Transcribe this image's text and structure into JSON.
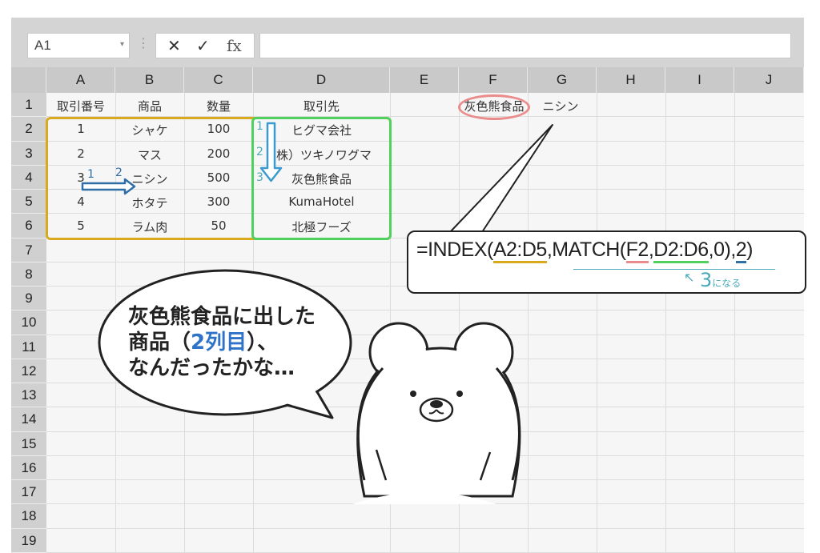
{
  "toolbar": {
    "name_box": "A1",
    "dropdown_icon": "▾",
    "separator": "⋮",
    "cancel_icon": "✕",
    "enter_icon": "✓",
    "fx_label": "fx",
    "formula_bar_value": ""
  },
  "columns": [
    "A",
    "B",
    "C",
    "D",
    "E",
    "F",
    "G",
    "H",
    "I",
    "J"
  ],
  "rows": [
    "1",
    "2",
    "3",
    "4",
    "5",
    "6",
    "7",
    "8",
    "9",
    "10",
    "11",
    "12",
    "13",
    "14",
    "15",
    "16",
    "17",
    "18",
    "19"
  ],
  "headers": [
    "取引番号",
    "商品",
    "数量",
    "取引先"
  ],
  "table": [
    [
      "1",
      "シャケ",
      "100",
      "ヒグマ会社"
    ],
    [
      "2",
      "マス",
      "200",
      "(株）ツキノワグマ"
    ],
    [
      "3",
      "ニシン",
      "500",
      "灰色熊食品"
    ],
    [
      "4",
      "ホタテ",
      "300",
      "KumaHotel"
    ],
    [
      "5",
      "ラム肉",
      "50",
      "北極フーズ"
    ]
  ],
  "lookup": {
    "f1": "灰色熊食品",
    "g1": "ニシン"
  },
  "step_labels": {
    "d_one": "1",
    "d_two": "2",
    "d_three": "3",
    "row_one": "1",
    "row_two": "2"
  },
  "callout": {
    "formula_prefix": "=INDEX(",
    "formula_a": "A2:D5",
    "formula_mid": ",MATCH(",
    "formula_f": "F2",
    "formula_comma": ",",
    "formula_d": "D2:D6",
    "formula_tail": ",0),",
    "formula_col": "2",
    "formula_close": ")",
    "note_number": "3",
    "note_suffix": "になる"
  },
  "speech_bubble": {
    "line1": "灰色熊食品に出した",
    "line2_pre": "商品（",
    "line2_blue": "2列目",
    "line2_post": "）、",
    "line3": "なんだったかな…"
  },
  "colors": {
    "yellow_range": "#d9aa1e",
    "green_range": "#4fd05f",
    "pink_highlight": "#ea8c8c",
    "blue_arrow": "#2f6fa8",
    "note_teal": "#4aaabb"
  }
}
